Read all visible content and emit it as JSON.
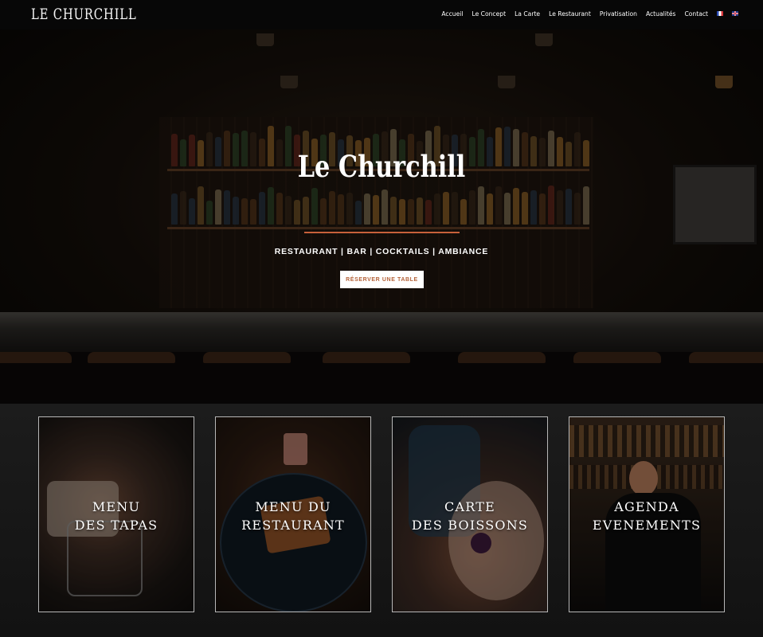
{
  "header": {
    "logo": "LE CHURCHILL",
    "nav": [
      "Accueil",
      "Le Concept",
      "La Carte",
      "Le Restaurant",
      "Privatisation",
      "Actualités",
      "Contact"
    ]
  },
  "hero": {
    "title": "Le Churchill",
    "subtitle": "RESTAURANT | BAR | COCKTAILS | AMBIANCE",
    "cta": "RÉSERVER UNE TABLE"
  },
  "cards": [
    {
      "label": "MENU\nDES TAPAS"
    },
    {
      "label": "MENU DU\nRESTAURANT"
    },
    {
      "label": "CARTE\nDES BOISSONS"
    },
    {
      "label": "AGENDA\nEVENEMENTS"
    }
  ],
  "colors": {
    "accent": "#c7613a",
    "button_text": "#b5633a",
    "background": "#0d0d0d"
  }
}
